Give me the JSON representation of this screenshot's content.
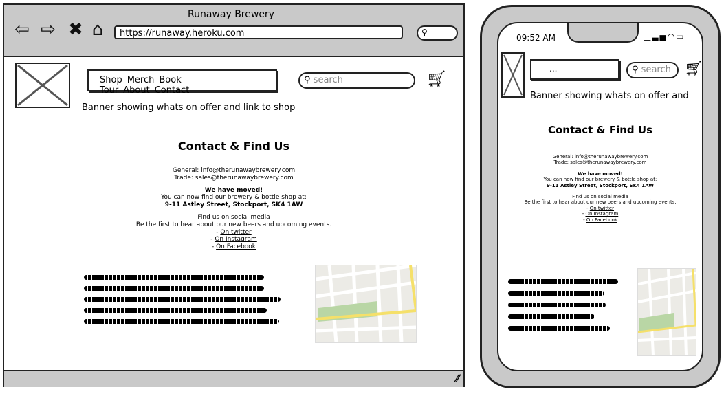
{
  "desktop": {
    "window_title": "Runaway Brewery",
    "url": "https://runaway.heroku.com",
    "nav_items": [
      "Shop",
      "Merch",
      "Book Tour",
      "About",
      "Contact"
    ],
    "search_placeholder": "search",
    "banner": "Banner showing whats on offer and link to shop",
    "heading": "Contact & Find Us",
    "general": "General: info@therunawaybrewery.com",
    "trade": "Trade: sales@therunawaybrewery.com",
    "moved_title": "We have moved!",
    "moved_text": "You can now find our brewery & bottle shop at:",
    "address": "9-11 Astley Street, Stockport, SK4 1AW",
    "social_title": "Find us on social media",
    "social_text": "Be the first to hear about our new beers and upcoming events.",
    "links": [
      "On twitter",
      "On Instagram",
      "On Facebook"
    ]
  },
  "mobile": {
    "time": "09:52 AM",
    "search_value": "...",
    "search_placeholder": "search",
    "banner": "Banner showing whats on offer and",
    "heading": "Contact & Find Us",
    "general": "General: info@therunawaybrewery.com",
    "trade": "Trade: sales@therunawaybrewery.com",
    "moved_title": "We have moved!",
    "moved_text": "You can now find our brewery & bottle shop at:",
    "address": "9-11 Astley Street, Stockport, SK4 1AW",
    "social_title": "Find us on social media",
    "social_text": "Be the first to hear about our new beers and upcoming events.",
    "links": [
      "On twitter",
      "On Instagram",
      "On Facebook"
    ]
  },
  "icons": {
    "back": "back-arrow-icon",
    "forward": "forward-arrow-icon",
    "close": "close-icon",
    "home": "home-icon",
    "search": "search-icon",
    "cart": "cart-icon",
    "logo_placeholder": "image-placeholder-icon",
    "signal": "signal-icon",
    "wifi": "wifi-icon",
    "battery": "battery-icon"
  },
  "colors": {
    "chrome": "#c9c9c9",
    "map_road": "#f5e06a",
    "map_park": "#b9d6a5"
  }
}
